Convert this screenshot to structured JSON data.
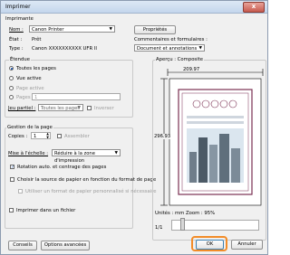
{
  "window": {
    "title": "Imprimer",
    "close_glyph": "x"
  },
  "printer": {
    "group_label": "Imprimante",
    "name_label": "Nom :",
    "name_value": "Canon Printer",
    "status_label": "État :",
    "status_value": "Prêt",
    "type_label": "Type :",
    "type_value": "Canon XXXXXXXXXX UFR II",
    "properties_button": "Propriétés",
    "comments_label": "Commentaires et formulaires :",
    "comments_value": "Document et annotations"
  },
  "range": {
    "group_label": "Étendue",
    "all_pages": "Toutes les pages",
    "current_view": "Vue active",
    "current_page": "Page active",
    "pages_label": "Pages",
    "pages_value": "1",
    "subset_label": "Jeu partiel :",
    "subset_value": "Toutes les pages",
    "reverse_label": "Inverser"
  },
  "handling": {
    "group_label": "Gestion de la page",
    "copies_label": "Copies :",
    "copies_value": "1",
    "collate_label": "Assembler",
    "scaling_label": "Mise à l'échelle :",
    "scaling_value": "Réduire à la zone d'impression",
    "auto_rotate_label": "Rotation auto. et centrage des pages",
    "choose_source_label": "Choisir la source de papier en fonction du format de page",
    "custom_paper_label": "Utiliser un format de papier personnalisé si nécessaire"
  },
  "print_to_file_label": "Imprimer dans un fichier",
  "preview": {
    "group_label": "Aperçu : Composite",
    "width_value": "209.97",
    "height_value": "296.93",
    "units_zoom": "Unités : mm Zoom : 95%",
    "page_counter": "1/1"
  },
  "buttons": {
    "advice": "Conseils",
    "advanced": "Options avancées",
    "ok": "OK",
    "cancel": "Annuler"
  },
  "colors": {
    "accent": "#f28c28",
    "brand": "#1a4fa3"
  }
}
